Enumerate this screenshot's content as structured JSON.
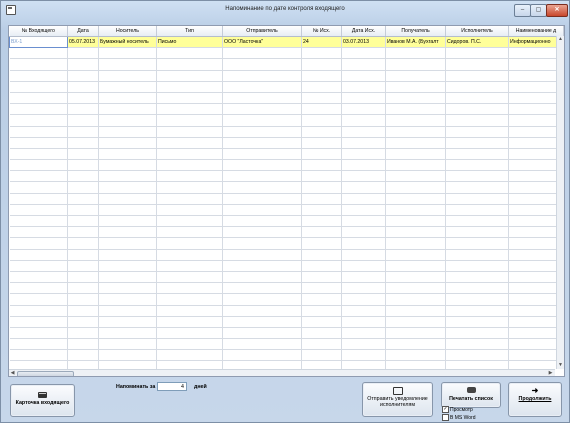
{
  "window": {
    "title": "Напоминание по дате контроля входящего"
  },
  "window_buttons": {
    "minimize": "–",
    "maximize": "▢",
    "close": "✕"
  },
  "table": {
    "columns": [
      "№ Входящего",
      "Дата",
      "Носитель",
      "Тип",
      "Отправитель",
      "№ Исх.",
      "Дата Исх.",
      "Получатель",
      "Исполнитель",
      "Наименование д"
    ],
    "rows": [
      [
        "ВХ-1",
        "05.07.2013",
        "Бумажный носитель",
        "Письмо",
        "ООО \"Ласточка\"",
        "24",
        "03.07.2013",
        "Иванов М.А. (Бухгалт",
        "Сидоров. П.С.",
        "Информационно"
      ]
    ],
    "empty_rows": 31
  },
  "footer": {
    "card_button": "Карточка входящего",
    "remind_label": "Напоминать за",
    "remind_value": "4",
    "remind_unit": "дней",
    "send_button": "Отправить уведомление исполнителям",
    "print_button": "Печатать список",
    "preview_label": "Просмотр",
    "preview_checked": true,
    "msword_label": "В MS Word",
    "msword_checked": false,
    "continue_button": "Продолжить"
  },
  "colors": {
    "selected_row": "#ffff99",
    "window_bg": "#c9d8ea",
    "close_button": "#c8472c"
  },
  "icons": {
    "card": "folder-icon",
    "send": "send-mail-icon",
    "print": "printer-icon",
    "continue": "arrow-right-icon"
  }
}
